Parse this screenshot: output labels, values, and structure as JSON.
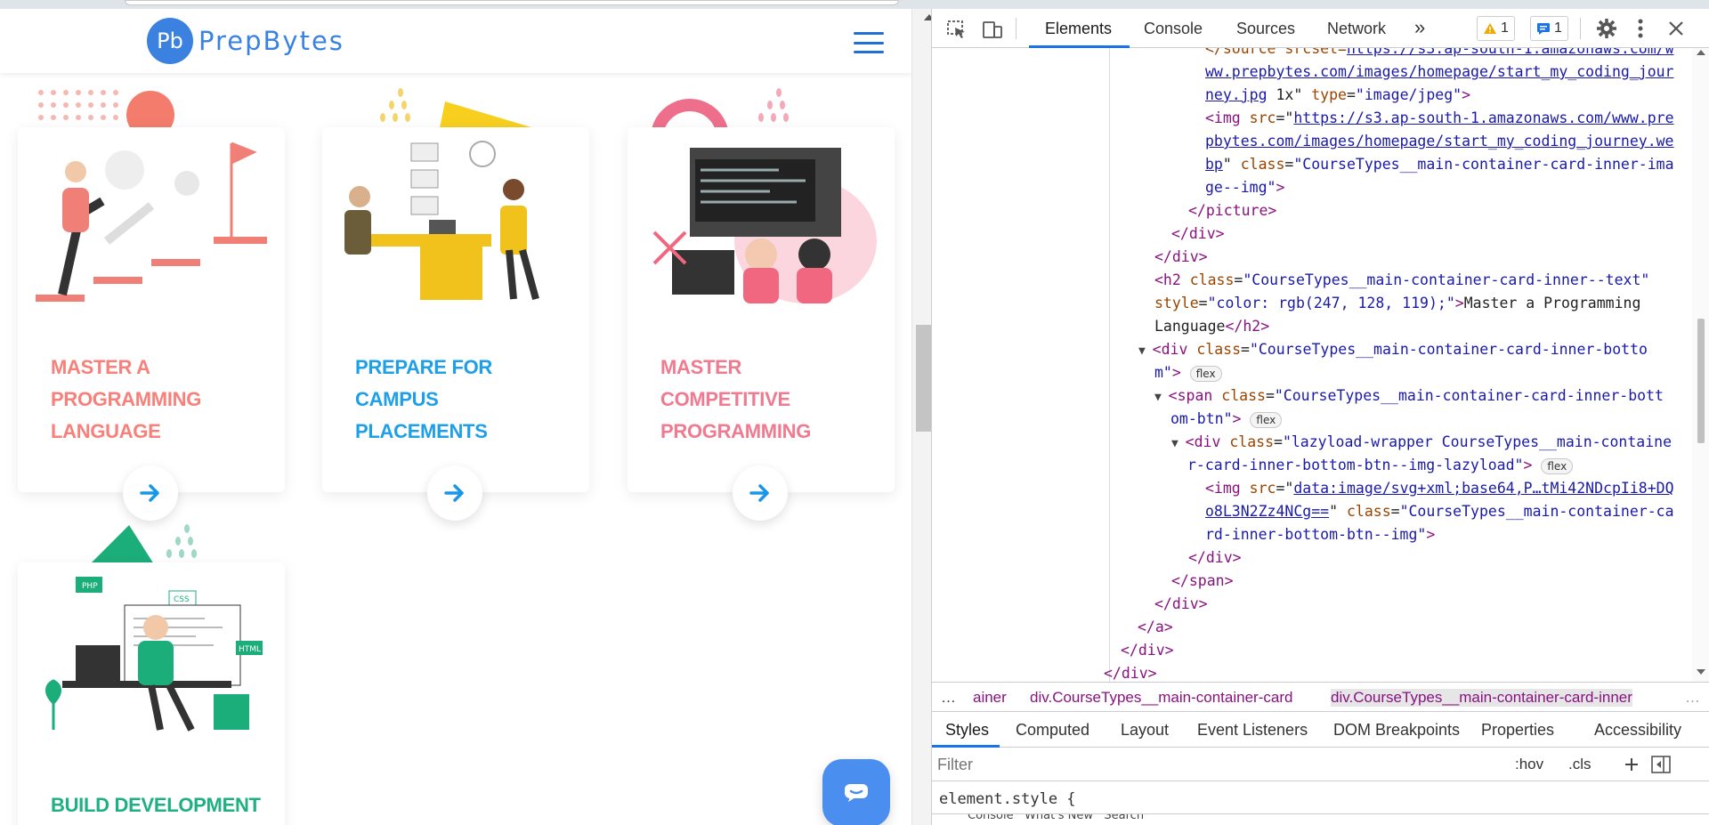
{
  "brand": {
    "logo_mark": "Pb",
    "name": "PrepBytes"
  },
  "cards": [
    {
      "title": "Master a Programming Language",
      "color": "#f7807a",
      "arrow_color": "#1a96e8"
    },
    {
      "title": "Prepare for Campus Placements",
      "color": "#1ea0e8",
      "arrow_color": "#1a96e8"
    },
    {
      "title": "Master Competitive Programming",
      "color": "#f07a90",
      "arrow_color": "#1a96e8"
    },
    {
      "title": "Build Development",
      "color": "#1fb082",
      "arrow_color": "#1a96e8"
    }
  ],
  "illustration_labels": {
    "php": "PHP",
    "css": "CSS",
    "html": "HTML"
  },
  "devtools": {
    "tabs": [
      "Elements",
      "Console",
      "Sources",
      "Network"
    ],
    "more": "»",
    "warnings_count": "1",
    "messages_count": "1",
    "dom_lines": {
      "l1_attr": "</source srcset=",
      "l1_url": "https://s3.ap-south-1.amazonaws.com/w",
      "l2_url": "ww.prepbytes.com/images/homepage/start_my_coding_jour",
      "l3_url": "ney.jpg",
      "l3_rest": " 1x\" ",
      "l3_type": "type",
      "l3_typev": "\"image/jpeg\"",
      "l4_tag": "<img ",
      "l4_attr": "src",
      "l4_url": "https://s3.ap-south-1.amazonaws.com/www.pre",
      "l5_url": "pbytes.com/images/homepage/start_my_coding_journey.we",
      "l6_url": "bp",
      "l6_attr": "class",
      "l6_val": "\"CourseTypes__main-container-card-inner-ima",
      "l7_val": "ge--img\"",
      "l8": "</picture>",
      "l9": "</div>",
      "l10": "</div>",
      "l11_tag": "<h2 ",
      "l11_attr": "class",
      "l11_val": "\"CourseTypes__main-container-card-inner--text\"",
      "l12_attr": "style",
      "l12_val": "\"color: rgb(247, 128, 119);\"",
      "l12_text": "Master a Programming",
      "l13_text": "Language",
      "l13_close": "</h2>",
      "l14_tag": "<div ",
      "l14_attr": "class",
      "l14_val": "\"CourseTypes__main-container-card-inner-botto",
      "l15_val": "m\"",
      "l16_tag": "<span ",
      "l16_attr": "class",
      "l16_val": "\"CourseTypes__main-container-card-inner-bott",
      "l17_val": "om-btn\"",
      "l18_tag": "<div ",
      "l18_attr": "class",
      "l18_val": "\"lazyload-wrapper CourseTypes__main-containe",
      "l19_val": "r-card-inner-bottom-btn--img-lazyload\"",
      "l20_tag": "<img ",
      "l20_attr": "src",
      "l20_url": "data:image/svg+xml;base64,P…tMi42NDcpIi8+DQ",
      "l21_url": "o8L3N2Zz4NCg==",
      "l21_attr": "class",
      "l21_val": "\"CourseTypes__main-container-ca",
      "l22_val": "rd-inner-bottom-btn--img\"",
      "l23": "</div>",
      "l24": "</span>",
      "l25": "</div>",
      "l26": "</a>",
      "l27": "</div>",
      "l28": "</div>",
      "flex": "flex"
    },
    "breadcrumbs": [
      "…",
      "ainer",
      "div.CourseTypes__main-container-card",
      "div.CourseTypes__main-container-card-inner",
      "…"
    ],
    "style_tabs": [
      "Styles",
      "Computed",
      "Layout",
      "Event Listeners",
      "DOM Breakpoints",
      "Properties",
      "Accessibility"
    ],
    "filter_placeholder": "Filter",
    "hov": ":hov",
    "cls": ".cls",
    "element_style": "element.style {",
    "drawer_text": "Console   What's New   Search"
  }
}
